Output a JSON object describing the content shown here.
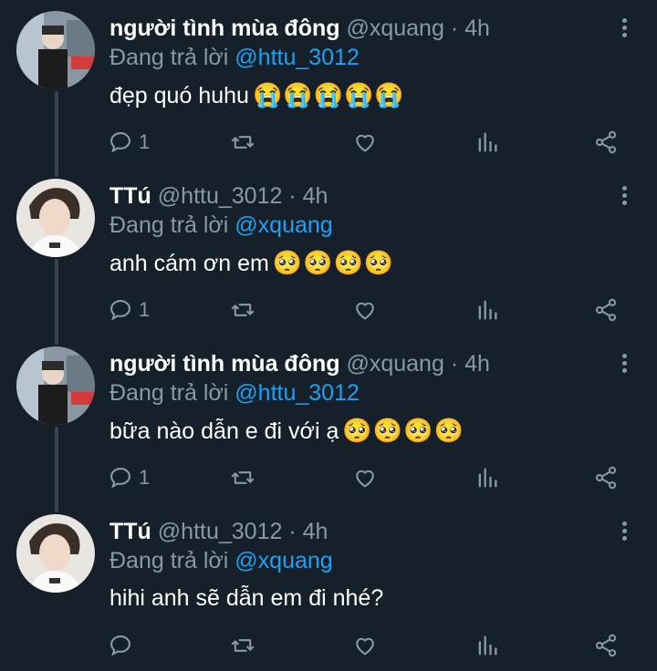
{
  "tweets": [
    {
      "name": "người tình mùa đông",
      "handle": "@xquang",
      "time": "4h",
      "reply_prefix": "Đang trả lời",
      "reply_to": "@httu_3012",
      "text": "đẹp quó huhu",
      "emoji": "😭😭😭😭😭",
      "reply_count": "1",
      "avatar": "avatar-street"
    },
    {
      "name": "TTú",
      "handle": "@httu_3012",
      "time": "4h",
      "reply_prefix": "Đang trả lời",
      "reply_to": "@xquang",
      "text": "anh cám ơn em",
      "emoji": "🥺🥺🥺🥺",
      "reply_count": "1",
      "avatar": "avatar-portrait"
    },
    {
      "name": "người tình mùa đông",
      "handle": "@xquang",
      "time": "4h",
      "reply_prefix": "Đang trả lời",
      "reply_to": "@httu_3012",
      "text": "bữa nào dẫn e đi với ạ",
      "emoji": "🥺🥺🥺🥺",
      "reply_count": "1",
      "avatar": "avatar-street"
    },
    {
      "name": "TTú",
      "handle": "@httu_3012",
      "time": "4h",
      "reply_prefix": "Đang trả lời",
      "reply_to": "@xquang",
      "text": "hihi anh sẽ dẫn em đi nhé?",
      "emoji": "",
      "reply_count": "",
      "avatar": "avatar-portrait"
    }
  ],
  "separator": "·",
  "colors": {
    "background": "#15202b",
    "secondary_text": "#8899a6",
    "mention": "#1da1f2",
    "thread_line": "#38444d"
  }
}
